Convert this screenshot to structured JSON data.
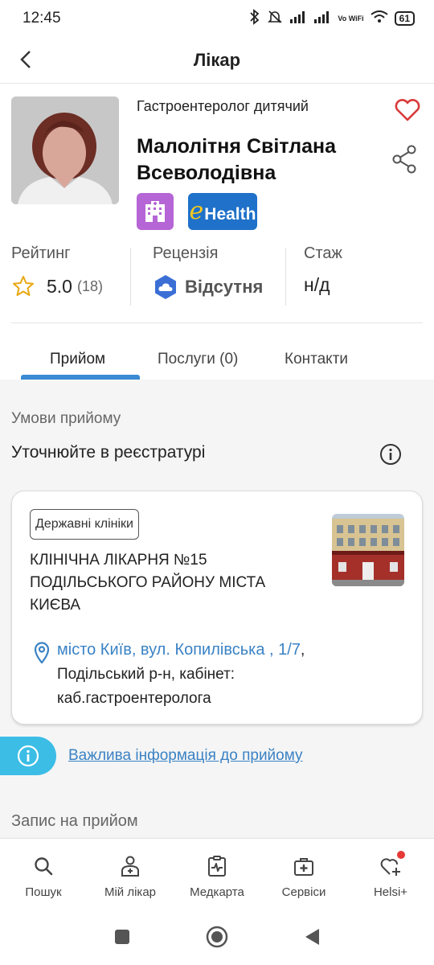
{
  "status_bar": {
    "time": "12:45",
    "network": "Vo WiFi",
    "battery": "61"
  },
  "header": {
    "title": "Лікар"
  },
  "doctor": {
    "specialty": "Гастроентеролог дитячий",
    "name": "Малолітня Світлана Всеволодівна",
    "badges": {
      "ehealth_e": "e",
      "ehealth_text": "Health"
    }
  },
  "stats": {
    "rating_label": "Рейтинг",
    "rating_value": "5.0",
    "rating_count": "(18)",
    "review_label": "Рецензія",
    "review_value": "Відсутня",
    "experience_label": "Стаж",
    "experience_value": "н/д"
  },
  "tabs": [
    {
      "label": "Прийом"
    },
    {
      "label": "Послуги (0)"
    },
    {
      "label": "Контакти"
    }
  ],
  "appointment": {
    "conditions_label": "Умови прийому",
    "conditions_text": "Уточнюйте в реєстратурі"
  },
  "clinic": {
    "tag": "Державні клініки",
    "name": "КЛІНІЧНА ЛІКАРНЯ №15 ПОДІЛЬСЬКОГО РАЙОНУ МІСТА КИЄВА",
    "address_link": "місто Київ, вул. Копилівська , 1/7",
    "address_rest": ", Подільський р-н, кабінет: каб.гастроентеролога"
  },
  "important_info": "Важлива інформація до прийому",
  "booking_label": "Запис на прийом",
  "bottom_nav": [
    {
      "label": "Пошук",
      "icon": "search-icon"
    },
    {
      "label": "Мій лікар",
      "icon": "doctor-icon"
    },
    {
      "label": "Медкарта",
      "icon": "medcard-icon"
    },
    {
      "label": "Сервіси",
      "icon": "services-icon"
    },
    {
      "label": "Helsi+",
      "icon": "heart-plus-icon"
    }
  ],
  "colors": {
    "accent": "#3a8ad4",
    "link": "#3a82c4",
    "heart": "#d93a3a",
    "clinic_badge": "#b565d6",
    "ehealth_badge": "#1f71c9",
    "info_pill": "#3bbde6"
  }
}
